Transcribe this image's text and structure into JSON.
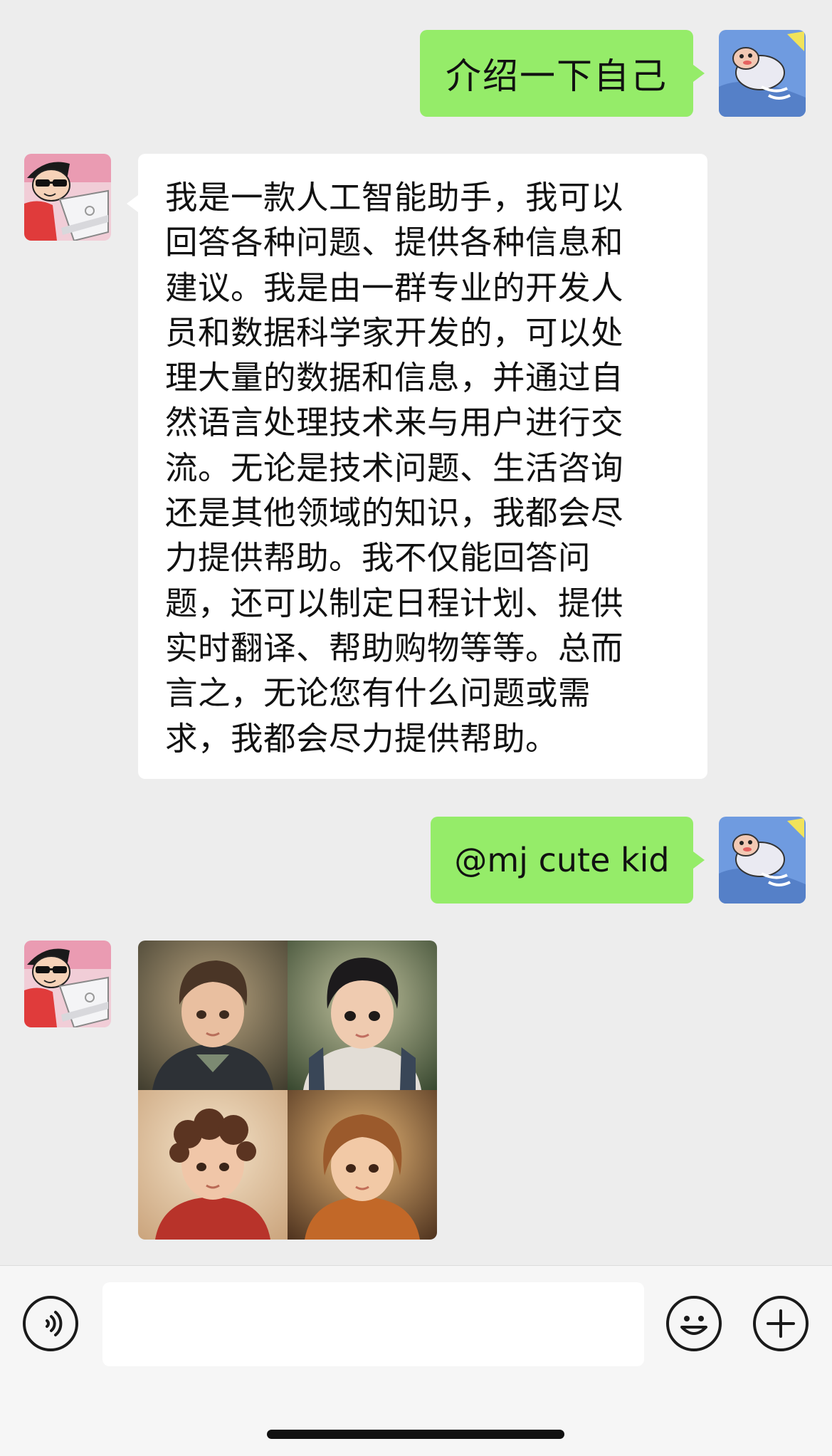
{
  "conversation": {
    "messages": [
      {
        "sender": "user",
        "type": "text",
        "text": "介绍一下自己"
      },
      {
        "sender": "bot",
        "type": "text",
        "lines": [
          "我是一款人工智能助手，我可以",
          "回答各种问题、提供各种信息和",
          "建议。我是由一群专业的开发人",
          "员和数据科学家开发的，可以处",
          "理大量的数据和信息，并通过自",
          "然语言处理技术来与用户进行交",
          "流。无论是技术问题、生活咨询",
          "还是其他领域的知识，我都会尽",
          "力提供帮助。我不仅能回答问",
          "题，还可以制定日程计划、提供",
          "实时翻译、帮助购物等等。总而",
          "言之，无论您有什么问题或需",
          "求，我都会尽力提供帮助。"
        ]
      },
      {
        "sender": "user",
        "type": "text",
        "text": "@mj cute kid"
      },
      {
        "sender": "bot",
        "type": "image",
        "image_grid": [
          "kid-portrait-1",
          "kid-portrait-2",
          "kid-portrait-3",
          "kid-portrait-4"
        ]
      }
    ]
  },
  "input_bar": {
    "value": "",
    "icons": [
      "voice-icon",
      "emoji-icon",
      "plus-icon"
    ]
  },
  "colors": {
    "background": "#ededed",
    "user_bubble": "#95ec69",
    "bot_bubble": "#ffffff",
    "input_bar": "#f6f6f6"
  }
}
